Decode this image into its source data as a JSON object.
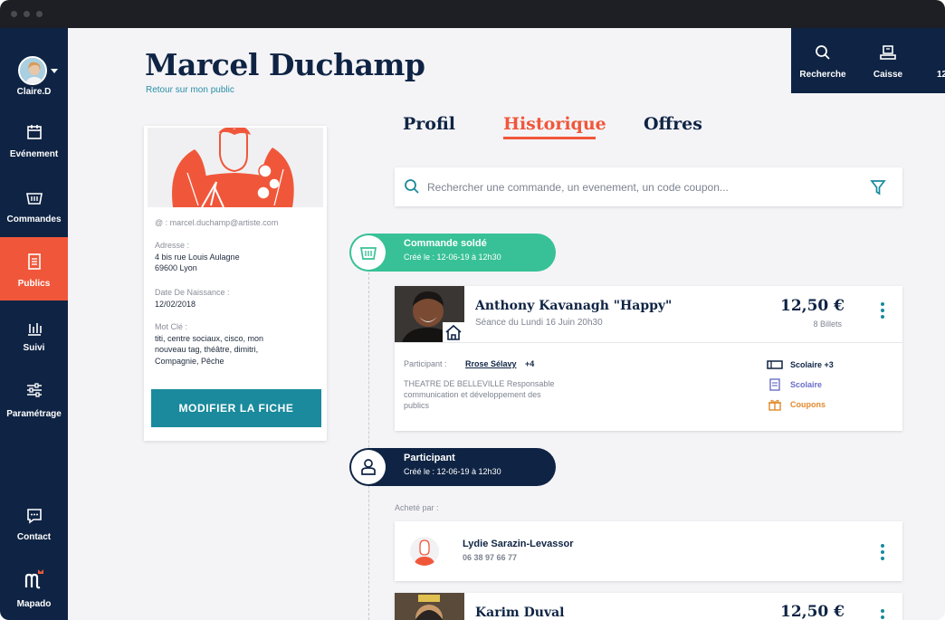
{
  "sidebar": {
    "user": "Claire.D",
    "items": [
      {
        "label": "Evénement"
      },
      {
        "label": "Commandes"
      },
      {
        "label": "Publics"
      },
      {
        "label": "Suivi"
      },
      {
        "label": "Paramétrage"
      },
      {
        "label": "Contact"
      },
      {
        "label": "Mapado"
      }
    ]
  },
  "header": {
    "title": "Marcel Duchamp",
    "back_link": "Retour sur mon public",
    "actions": [
      {
        "label": "Recherche",
        "icon": "search-icon"
      },
      {
        "label": "Caisse",
        "icon": "cash-register-icon"
      },
      {
        "label": "12"
      }
    ]
  },
  "profile": {
    "email": "@ : marcel.duchamp@artiste.com",
    "address_label": "Adresse :",
    "address_line1": "4 bis rue Louis Aulagne",
    "address_line2": "69600 Lyon",
    "birth_label": "Date De Naissance :",
    "birth_value": "12/02/2018",
    "keyword_label": "Mot Clé :",
    "keyword_line1": "titi, centre sociaux, cisco, mon",
    "keyword_line2": "nouveau tag, théâtre, dimitri,",
    "keyword_line3": "Compagnie, Pêche",
    "edit_button": "MODIFIER LA FICHE"
  },
  "tabs": [
    {
      "label": "Profil"
    },
    {
      "label": "Historique"
    },
    {
      "label": "Offres"
    }
  ],
  "search": {
    "placeholder": "Rechercher une commande, un evenement, un code coupon..."
  },
  "timeline": {
    "event1": {
      "title": "Commande soldé",
      "date": "Créé le : 12-06-19 à 12h30"
    },
    "order1": {
      "title": "Anthony Kavanagh \"Happy\"",
      "subtitle": "Séance du Lundi 16 Juin 20h30",
      "price": "12,50 €",
      "tickets": "8 Billets",
      "participant_label": "Participant :",
      "participant_name": "Rrose Sélavy",
      "participant_extra": "+4",
      "venue_line1": "THEATRE DE BELLEVILLE Responsable",
      "venue_line2": "communication et développement des",
      "venue_line3": "publics",
      "tag1": "Scolaire +3",
      "tag2": "Scolaire",
      "tag3": "Coupons"
    },
    "event2": {
      "title": "Participant",
      "date": "Créé le : 12-06-19 à 12h30"
    },
    "bought_by": "Acheté par :",
    "buyer": {
      "name": "Lydie Sarazin-Levassor",
      "phone": "06 38 97 66 77"
    },
    "order2": {
      "title": "Karim Duval",
      "price": "12,50 €"
    }
  },
  "colors": {
    "accent": "#f0573a",
    "navy": "#0f2444",
    "teal": "#1a8a9c",
    "green": "#38c196",
    "orange": "#e08a2c",
    "purple": "#6a6fc8"
  }
}
